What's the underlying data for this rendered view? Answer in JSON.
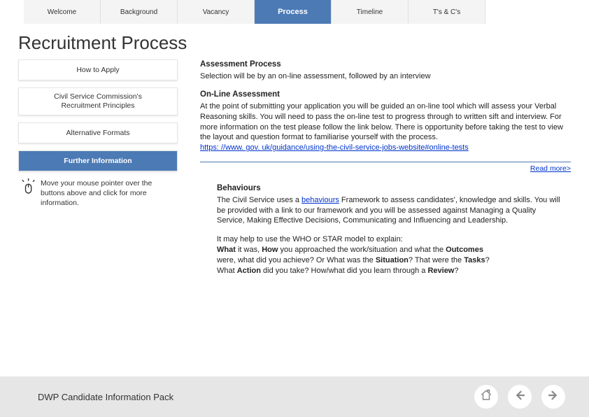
{
  "nav": {
    "tabs": [
      {
        "label": "Welcome"
      },
      {
        "label": "Background"
      },
      {
        "label": "Vacancy"
      },
      {
        "label": "Process"
      },
      {
        "label": "Timeline"
      },
      {
        "label": "T's & C's"
      }
    ]
  },
  "page": {
    "title": "Recruitment Process"
  },
  "sidebar": {
    "items": [
      {
        "label": "How to Apply"
      },
      {
        "label_l1": "Civil Service Commission's",
        "label_l2": "Recruitment Principles"
      },
      {
        "label": "Alternative Formats"
      },
      {
        "label": "Further Information"
      }
    ],
    "hint": "Move your mouse pointer over the buttons above and click for more information."
  },
  "content": {
    "assessment": {
      "heading": "Assessment Process",
      "text": "Selection will be by an on-line assessment, followed by an interview"
    },
    "online": {
      "heading": "On-Line Assessment",
      "text": "At the point of submitting your application you will be guided an on-line tool which will assess your Verbal Reasoning skills. You will need to pass the on-line test to progress through to written sift and interview. For more information on the test please follow the link below. There is opportunity before taking the test to view the layout and question format to familiarise yourself with the process.",
      "link": "https: //www. gov. uk/guidance/using-the-civil-service-jobs-website#online-tests"
    },
    "readmore": "Read more>",
    "behaviours": {
      "heading": "Behaviours",
      "text_pre": "The Civil Service uses a ",
      "text_link": "behaviours",
      "text_post": " Framework to assess candidates', knowledge and skills. You will be provided with a link to our framework and you will be assessed against Managing a Quality Service, Making Effective Decisions, Communicating and Influencing and Leadership."
    },
    "model": {
      "l1": "It may help to use the WHO or STAR model to explain:",
      "b1": "What",
      "t1": " it was, ",
      "b2": "How",
      "t2": " you approached the work/situation and what the ",
      "b3": "Outcomes",
      "t3": "were, what did you achieve? Or What was the ",
      "b4": "Situation",
      "t4": "? That were the ",
      "b5": "Tasks",
      "t5": "?",
      "t6": "What ",
      "b6": "Action",
      "t7": " did you take? How/what did you learn through a ",
      "b7": "Review",
      "t8": "?"
    }
  },
  "footer": {
    "title": "DWP Candidate Information Pack"
  }
}
